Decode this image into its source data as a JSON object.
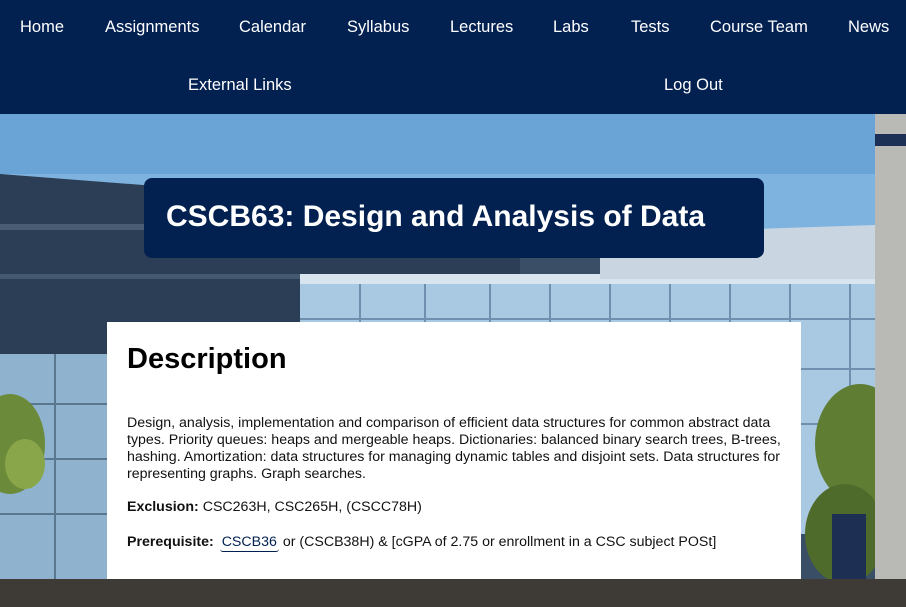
{
  "nav": {
    "items": [
      {
        "label": "Home"
      },
      {
        "label": "Assignments"
      },
      {
        "label": "Calendar"
      },
      {
        "label": "Syllabus"
      },
      {
        "label": "Lectures"
      },
      {
        "label": "Labs"
      },
      {
        "label": "Tests"
      },
      {
        "label": "Course Team"
      },
      {
        "label": "News"
      },
      {
        "label": "External Links"
      },
      {
        "label": "Log Out"
      }
    ]
  },
  "course": {
    "title": "CSCB63: Design and Analysis of Data"
  },
  "description": {
    "heading": "Description",
    "body": "Design, analysis, implementation and comparison of efficient data structures for common abstract data types. Priority queues: heaps and mergeable heaps. Dictionaries: balanced binary search trees, B-trees, hashing. Amortization: data structures for managing dynamic tables and disjoint sets. Data structures for representing graphs. Graph searches.",
    "exclusion_label": "Exclusion:",
    "exclusion_value": "CSC263H, CSC265H, (CSCC78H)",
    "prerequisite_label": "Prerequisite:",
    "prerequisite_link": "CSCB36",
    "prerequisite_rest": "or (CSCB38H) & [cGPA of 2.75 or enrollment in a CSC subject POSt]"
  },
  "colors": {
    "nav_bg": "#022050",
    "banner_bg": "#022050",
    "card_bg": "#ffffff",
    "nav_text": "#ffffff"
  }
}
